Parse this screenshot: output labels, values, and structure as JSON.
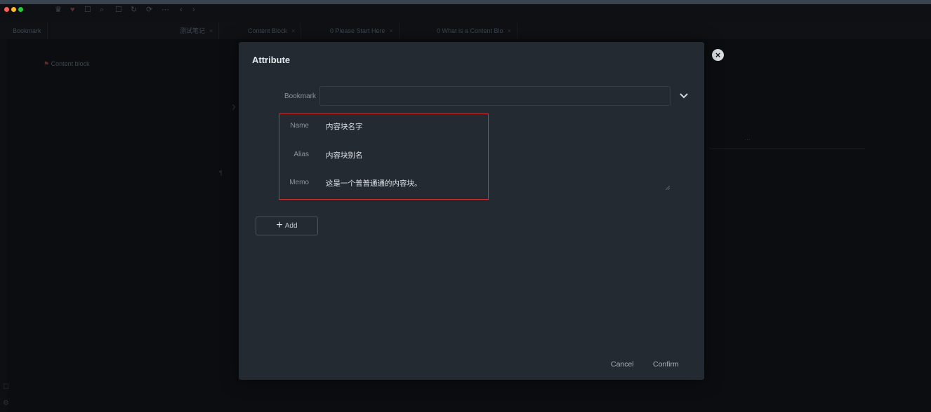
{
  "app": {
    "toolbar_icons": [
      "heart-icon",
      "square-icon",
      "search-icon",
      "square-icon",
      "history-icon",
      "sync-icon",
      "more-icon",
      "back-icon",
      "forward-icon"
    ],
    "tabs": [
      {
        "label": "Bookmark"
      },
      {
        "label": "测试笔记"
      },
      {
        "label": "Content Block"
      },
      {
        "label": "0 Please Start Here"
      },
      {
        "label": "0 What is a Content Blo"
      }
    ],
    "sidebar": {
      "items": [
        {
          "label": "Content block"
        }
      ]
    },
    "editor": {
      "right_fragment": "…"
    }
  },
  "modal": {
    "title": "Attribute",
    "fields": {
      "bookmark_label": "Bookmark",
      "bookmark_value": "",
      "name_label": "Name",
      "name_value": "内容块名字",
      "alias_label": "Alias",
      "alias_value": "内容块别名",
      "memo_label": "Memo",
      "memo_value": "这是一个普普通通的内容块。"
    },
    "add_label": "Add",
    "cancel_label": "Cancel",
    "confirm_label": "Confirm"
  },
  "colors": {
    "modal_bg": "#232a32",
    "highlight": "#d23131",
    "close_bg": "#d8dde2"
  }
}
